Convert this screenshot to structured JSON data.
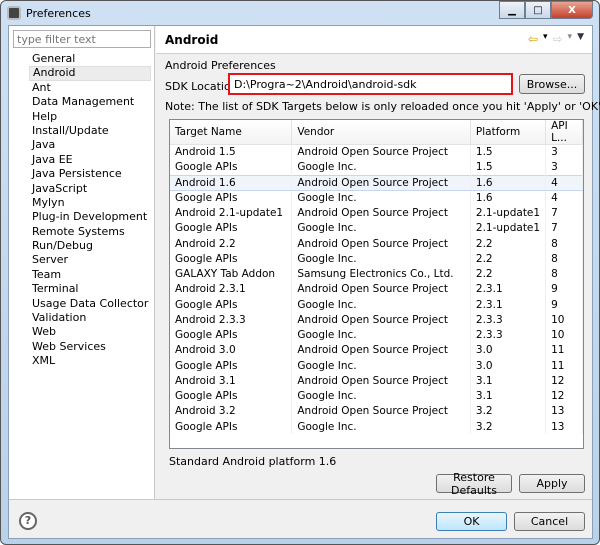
{
  "window": {
    "title": "Preferences",
    "minimize": "▁",
    "maximize": "□",
    "close": "X"
  },
  "filter": {
    "placeholder": "type filter text"
  },
  "tree": [
    "General",
    "Android",
    "Ant",
    "Data Management",
    "Help",
    "Install/Update",
    "Java",
    "Java EE",
    "Java Persistence",
    "JavaScript",
    "Mylyn",
    "Plug-in Development",
    "Remote Systems",
    "Run/Debug",
    "Server",
    "Team",
    "Terminal",
    "Usage Data Collector",
    "Validation",
    "Web",
    "Web Services",
    "XML"
  ],
  "page": {
    "title": "Android",
    "section": "Android Preferences",
    "sdk_label": "SDK Location:",
    "sdk_value": "D:\\Progra~2\\Android\\android-sdk",
    "browse": "Browse...",
    "note": "Note: The list of SDK Targets below is only reloaded once you hit 'Apply' or 'OK'.",
    "description": "Standard Android platform 1.6",
    "restore": "Restore Defaults",
    "apply": "Apply"
  },
  "nav": {
    "back": "⇦",
    "forward": "⇨",
    "dropdown": "▾",
    "menu": "▼"
  },
  "table": {
    "columns": [
      "Target Name",
      "Vendor",
      "Platform",
      "API L..."
    ],
    "selected_index": 2,
    "rows": [
      [
        "Android 1.5",
        "Android Open Source Project",
        "1.5",
        "3"
      ],
      [
        "Google APIs",
        "Google Inc.",
        "1.5",
        "3"
      ],
      [
        "Android 1.6",
        "Android Open Source Project",
        "1.6",
        "4"
      ],
      [
        "Google APIs",
        "Google Inc.",
        "1.6",
        "4"
      ],
      [
        "Android 2.1-update1",
        "Android Open Source Project",
        "2.1-update1",
        "7"
      ],
      [
        "Google APIs",
        "Google Inc.",
        "2.1-update1",
        "7"
      ],
      [
        "Android 2.2",
        "Android Open Source Project",
        "2.2",
        "8"
      ],
      [
        "Google APIs",
        "Google Inc.",
        "2.2",
        "8"
      ],
      [
        "GALAXY Tab Addon",
        "Samsung Electronics Co., Ltd.",
        "2.2",
        "8"
      ],
      [
        "Android 2.3.1",
        "Android Open Source Project",
        "2.3.1",
        "9"
      ],
      [
        "Google APIs",
        "Google Inc.",
        "2.3.1",
        "9"
      ],
      [
        "Android 2.3.3",
        "Android Open Source Project",
        "2.3.3",
        "10"
      ],
      [
        "Google APIs",
        "Google Inc.",
        "2.3.3",
        "10"
      ],
      [
        "Android 3.0",
        "Android Open Source Project",
        "3.0",
        "11"
      ],
      [
        "Google APIs",
        "Google Inc.",
        "3.0",
        "11"
      ],
      [
        "Android 3.1",
        "Android Open Source Project",
        "3.1",
        "12"
      ],
      [
        "Google APIs",
        "Google Inc.",
        "3.1",
        "12"
      ],
      [
        "Android 3.2",
        "Android Open Source Project",
        "3.2",
        "13"
      ],
      [
        "Google APIs",
        "Google Inc.",
        "3.2",
        "13"
      ]
    ]
  },
  "footer": {
    "help": "?",
    "ok": "OK",
    "cancel": "Cancel"
  }
}
